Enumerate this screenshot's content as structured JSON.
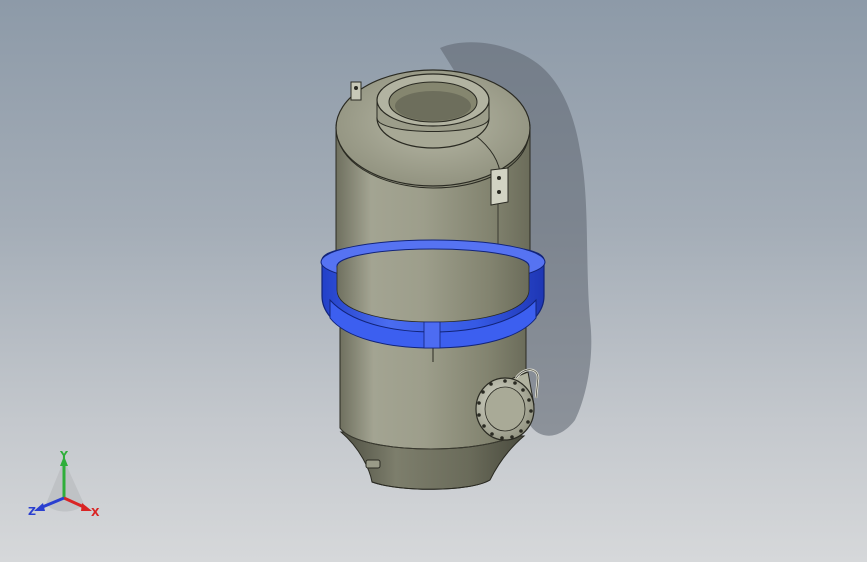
{
  "viewport": {
    "background_top": "#8d9aa8",
    "background_bottom": "#d6d8da"
  },
  "model": {
    "body_color": "#8e8f7c",
    "flange_color": "#2f55e0",
    "edge_color": "#2a2a22"
  },
  "triad": {
    "x_label": "X",
    "y_label": "Y",
    "z_label": "Z",
    "x_color": "#d92424",
    "y_color": "#2fae3a",
    "z_color": "#2a3fd0"
  }
}
